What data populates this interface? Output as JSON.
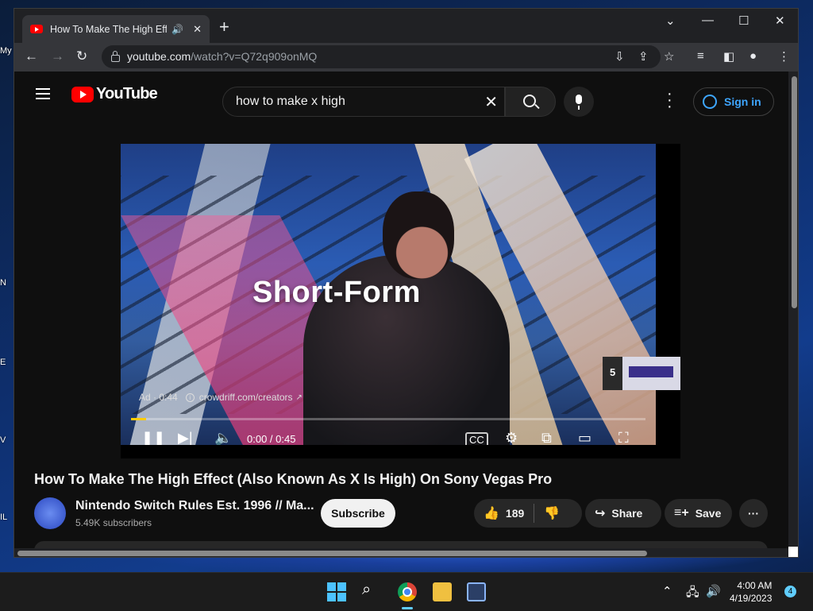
{
  "browser": {
    "tab_title": "How To Make The High Effec",
    "url_host": "youtube.com",
    "url_path": "/watch?v=Q72q909onMQ"
  },
  "youtube": {
    "logo_text": "YouTube",
    "search_query": "how to make x high",
    "sign_in_label": "Sign in",
    "player": {
      "headline": "Short-Form",
      "ad_label": "Ad · 0:44",
      "ad_link": "crowdriff.com/creators",
      "time": "0:00 / 0:45",
      "progress": 0.03,
      "skip_count": "5"
    },
    "video_title": "How To Make The High Effect (Also Known As X Is High) On Sony Vegas Pro",
    "channel_name": "Nintendo Switch Rules Est. 1996 // Ma...",
    "subscribers": "5.49K subscribers",
    "subscribe_label": "Subscribe",
    "like_count": "189",
    "share_label": "Share",
    "save_label": "Save"
  },
  "taskbar": {
    "time": "4:00 AM",
    "date": "4/19/2023",
    "notification_count": "4"
  },
  "colors": {
    "youtube_red": "#ff0000",
    "link_blue": "#3ea6ff",
    "ad_progress": "#ffcc00"
  }
}
